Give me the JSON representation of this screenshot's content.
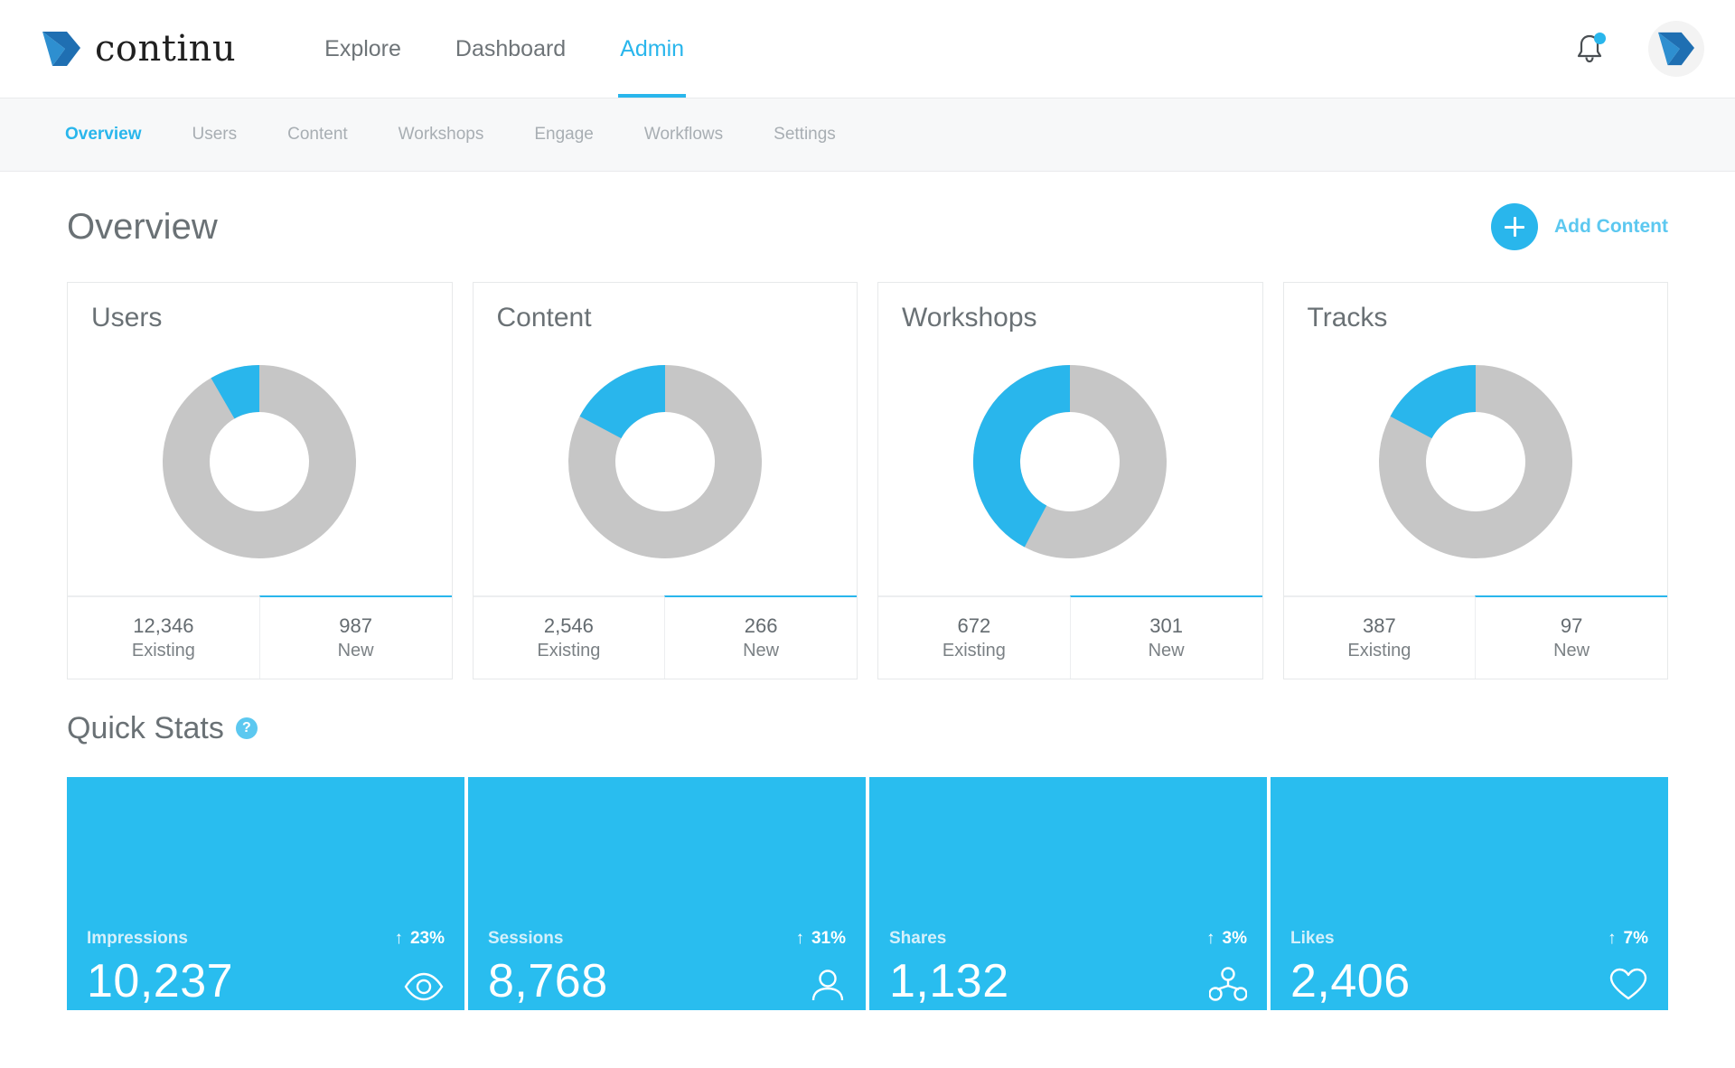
{
  "brand": {
    "name": "continu",
    "logo_icon": "continu-chevron-logo"
  },
  "topnav": {
    "links": [
      {
        "label": "Explore",
        "active": false
      },
      {
        "label": "Dashboard",
        "active": false
      },
      {
        "label": "Admin",
        "active": true
      }
    ],
    "notification_icon": "bell-icon",
    "notification_badge": true,
    "avatar_icon": "user-avatar"
  },
  "subnav": {
    "tabs": [
      {
        "label": "Overview",
        "active": true
      },
      {
        "label": "Users",
        "active": false
      },
      {
        "label": "Content",
        "active": false
      },
      {
        "label": "Workshops",
        "active": false
      },
      {
        "label": "Engage",
        "active": false
      },
      {
        "label": "Workflows",
        "active": false
      },
      {
        "label": "Settings",
        "active": false
      }
    ]
  },
  "page": {
    "title": "Overview",
    "add_content_label": "Add Content",
    "add_content_icon": "plus-icon"
  },
  "cards": [
    {
      "title": "Users",
      "existing_value": "12,346",
      "existing_label": "Existing",
      "new_value": "987",
      "new_label": "New",
      "arc_degrees": 30
    },
    {
      "title": "Content",
      "existing_value": "2,546",
      "existing_label": "Existing",
      "new_value": "266",
      "new_label": "New",
      "arc_degrees": 62
    },
    {
      "title": "Workshops",
      "existing_value": "672",
      "existing_label": "Existing",
      "new_value": "301",
      "new_label": "New",
      "arc_degrees": 152
    },
    {
      "title": "Tracks",
      "existing_value": "387",
      "existing_label": "Existing",
      "new_value": "97",
      "new_label": "New",
      "arc_degrees": 62
    }
  ],
  "quick_stats": {
    "title": "Quick Stats",
    "help_icon": "question-mark-icon",
    "help_glyph": "?",
    "tiles": [
      {
        "label": "Impressions",
        "value": "10,237",
        "delta": "23%",
        "trend": "up",
        "trend_glyph": "↑",
        "icon": "eye-icon"
      },
      {
        "label": "Sessions",
        "value": "8,768",
        "delta": "31%",
        "trend": "up",
        "trend_glyph": "↑",
        "icon": "person-icon"
      },
      {
        "label": "Shares",
        "value": "1,132",
        "delta": "3%",
        "trend": "up",
        "trend_glyph": "↑",
        "icon": "share-network-icon"
      },
      {
        "label": "Likes",
        "value": "2,406",
        "delta": "7%",
        "trend": "up",
        "trend_glyph": "↑",
        "icon": "heart-icon"
      }
    ]
  },
  "chart_data": {
    "type": "pie",
    "title": "Overview donut charts",
    "charts": [
      {
        "title": "Users",
        "labels": [
          "New",
          "Existing"
        ],
        "values": [
          987,
          12346
        ],
        "colors": [
          "#29b6ec",
          "#c6c6c6"
        ]
      },
      {
        "title": "Content",
        "labels": [
          "New",
          "Existing"
        ],
        "values": [
          266,
          2546
        ],
        "colors": [
          "#29b6ec",
          "#c6c6c6"
        ]
      },
      {
        "title": "Workshops",
        "labels": [
          "New",
          "Existing"
        ],
        "values": [
          301,
          672
        ],
        "colors": [
          "#29b6ec",
          "#c6c6c6"
        ]
      },
      {
        "title": "Tracks",
        "labels": [
          "New",
          "Existing"
        ],
        "values": [
          97,
          387
        ],
        "colors": [
          "#29b6ec",
          "#c6c6c6"
        ]
      }
    ]
  },
  "colors": {
    "accent": "#29b6ec",
    "tile_blue": "#29bdef",
    "donut_gray": "#c6c6c6",
    "text_gray": "#6a7175"
  }
}
